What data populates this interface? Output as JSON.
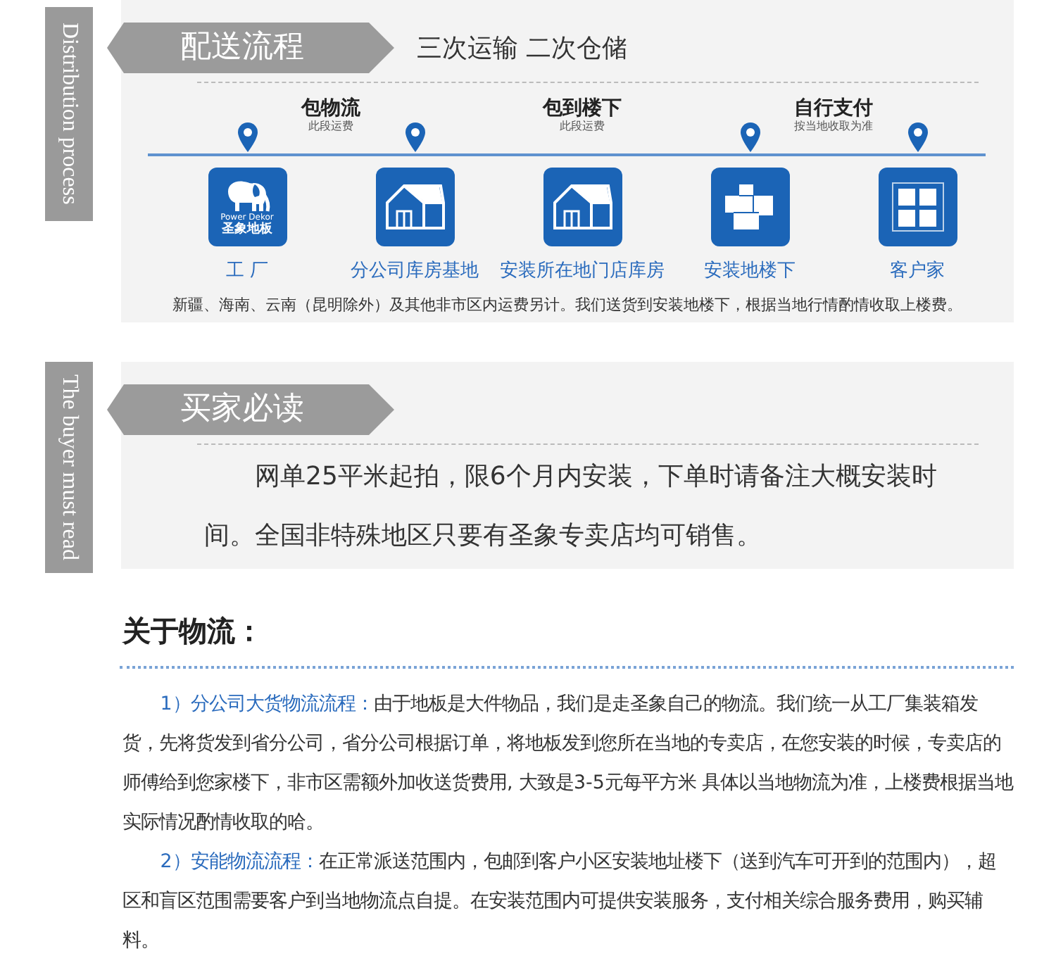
{
  "distribution": {
    "tab": "Distribution process",
    "title": "配送流程",
    "subtitle": "三次运输 二次仓储",
    "stages": [
      {
        "title": "包物流",
        "note": "此段运费"
      },
      {
        "title": "包到楼下",
        "note": "此段运费"
      },
      {
        "title": "自行支付",
        "note": "按当地收取为准"
      }
    ],
    "steps": [
      {
        "kind": "logo",
        "label": "工 厂",
        "pin": true,
        "logo_text": "圣象地板",
        "logo_small": "Power Dekor"
      },
      {
        "kind": "warehouse",
        "label": "分公司库房基地",
        "pin": true
      },
      {
        "kind": "warehouse",
        "label": "安装所在地门店库房",
        "pin": false
      },
      {
        "kind": "boxes",
        "label": "安装地楼下",
        "pin": true
      },
      {
        "kind": "window",
        "label": "客户家",
        "pin": true
      }
    ],
    "note": "新疆、海南、云南（昆明除外）及其他非市区内运费另计。我们送货到安装地楼下，根据当地行情酌情收取上楼费。"
  },
  "buyer": {
    "tab": "The buyer must read",
    "title": "买家必读",
    "text": "网单25平米起拍，限6个月内安装，下单时请备注大概安装时间。全国非特殊地区只要有圣象专卖店均可销售。"
  },
  "logistics": {
    "heading": "关于物流：",
    "items": [
      {
        "label": "1）分公司大货物流流程：",
        "text": "由于地板是大件物品，我们是走圣象自己的物流。我们统一从工厂集装箱发货，先将货发到省分公司，省分公司根据订单，将地板发到您所在当地的专卖店，在您安装的时候，专卖店的师傅给到您家楼下，非市区需额外加收送货费用, 大致是3-5元每平方米  具体以当地物流为准，上楼费根据当地实际情况酌情收取的哈。"
      },
      {
        "label": "2）安能物流流程：",
        "text": "在正常派送范围内，包邮到客户小区安装地址楼下（送到汽车可开到的范围内），超区和盲区范围需要客户到当地物流点自提。在安装范围内可提供安装服务，支付相关综合服务费用，购买辅料。"
      }
    ]
  }
}
